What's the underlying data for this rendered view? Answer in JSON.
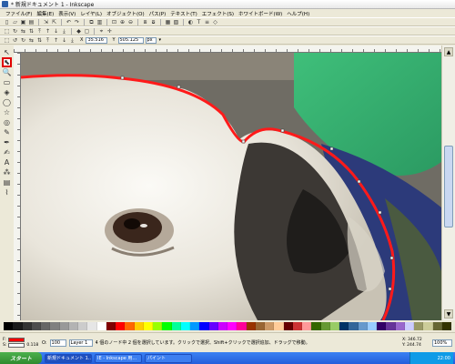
{
  "window": {
    "title": "* 新規ドキュメント 1 - Inkscape",
    "app_icon": "inkscape-icon"
  },
  "menu": [
    "ファイル(F)",
    "編集(E)",
    "表示(V)",
    "レイヤ(L)",
    "オブジェクト(O)",
    "パス(P)",
    "テキスト(T)",
    "エフェクト(S)",
    "ホワイトボード(W)",
    "ヘルプ(H)"
  ],
  "toolbar_main": [
    "new-icon",
    "open-icon",
    "save-icon",
    "print-icon",
    "sep",
    "import-icon",
    "export-icon",
    "sep",
    "undo-icon",
    "redo-icon",
    "sep",
    "copy-icon",
    "paste-icon",
    "sep",
    "zoom-fit-icon",
    "zoom-in-icon",
    "zoom-out-icon",
    "sep",
    "duplicate-icon",
    "clone-icon",
    "sep",
    "group-icon",
    "ungroup-icon",
    "sep",
    "fill-stroke-icon",
    "text-icon",
    "align-icon",
    "xml-editor-icon"
  ],
  "toolbar_commands": [
    "select-all-icon",
    "rotate-icon",
    "flip-h-icon",
    "flip-v-icon",
    "raise-top-icon",
    "raise-icon",
    "lower-icon",
    "lower-bottom-icon",
    "sep",
    "node-mode-icon",
    "bbox-icon",
    "sep",
    "snap-icon",
    "snap-nodes-icon"
  ],
  "toolbar_tool_controls": {
    "icons": [
      "select-all-in-layer-icon",
      "rotate-90-ccw-icon",
      "rotate-90-cw-icon",
      "flip-horizontal-icon",
      "flip-vertical-icon",
      "raise-to-top-icon",
      "raise-icon",
      "lower-icon",
      "lower-to-bottom-icon"
    ],
    "x_label": "X",
    "x_value": "35.516",
    "y_label": "Y",
    "y_value": "505.125",
    "unit": "px"
  },
  "tools": [
    {
      "name": "selector-tool",
      "glyph": "↖",
      "active": false
    },
    {
      "name": "node-tool",
      "glyph": "⬉",
      "active": true
    },
    {
      "name": "zoom-tool",
      "glyph": "🔍",
      "active": false
    },
    {
      "name": "rectangle-tool",
      "glyph": "▭",
      "active": false
    },
    {
      "name": "3d-box-tool",
      "glyph": "◈",
      "active": false
    },
    {
      "name": "ellipse-tool",
      "glyph": "◯",
      "active": false
    },
    {
      "name": "star-tool",
      "glyph": "☆",
      "active": false
    },
    {
      "name": "spiral-tool",
      "glyph": "◎",
      "active": false
    },
    {
      "name": "pencil-tool",
      "glyph": "✎",
      "active": false
    },
    {
      "name": "pen-tool",
      "glyph": "✒",
      "active": false
    },
    {
      "name": "calligraphy-tool",
      "glyph": "✍",
      "active": false
    },
    {
      "name": "text-tool",
      "glyph": "A",
      "active": false
    },
    {
      "name": "spray-tool",
      "glyph": "⁂",
      "active": false
    },
    {
      "name": "gradient-tool",
      "glyph": "▤",
      "active": false
    },
    {
      "name": "dropper-tool",
      "glyph": "⌇",
      "active": false
    }
  ],
  "palette": [
    "#000000",
    "#1a1a1a",
    "#333333",
    "#4d4d4d",
    "#666666",
    "#808080",
    "#999999",
    "#b3b3b3",
    "#cccccc",
    "#e6e6e6",
    "#ffffff",
    "#800000",
    "#ff0000",
    "#ff6600",
    "#ffcc00",
    "#ffff00",
    "#99ff00",
    "#00ff00",
    "#00ff99",
    "#00ffff",
    "#0099ff",
    "#0000ff",
    "#6600ff",
    "#cc00ff",
    "#ff00ff",
    "#ff0099",
    "#993300",
    "#996633",
    "#cc9966",
    "#ffcc99",
    "#660000",
    "#cc3333",
    "#ff9999",
    "#336600",
    "#669933",
    "#99cc66",
    "#003366",
    "#336699",
    "#6699cc",
    "#99ccff",
    "#330066",
    "#663399",
    "#9966cc",
    "#ccccff",
    "#999966",
    "#cccc99",
    "#666633",
    "#333300"
  ],
  "status": {
    "fill_label": "F:",
    "stroke_label": "S:",
    "fill_color": "#ff0000",
    "stroke_width": "0.118",
    "opacity_label": "O:",
    "opacity_value": "100",
    "layer": "Layer 1",
    "message": "4 個のノード中 2 個を選択しています。クリックで選択、Shift+クリックで選択追加、ドラッグで移動。",
    "x_coord": "X: 346.72",
    "y_coord": "Y: 244.74",
    "zoom": "100%"
  },
  "taskbar": {
    "start_label": "スタート",
    "tasks": [
      "新規ドキュメント 1...",
      "IE - Inkscape 用...",
      "パイント"
    ],
    "tray_time": "22:00"
  }
}
